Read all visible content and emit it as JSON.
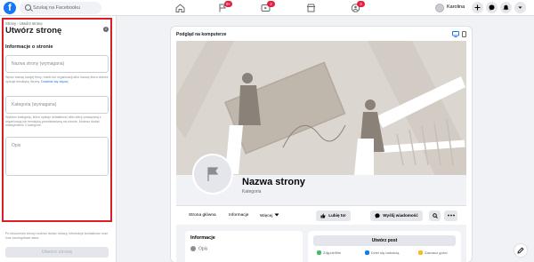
{
  "header": {
    "logo": "f",
    "search_placeholder": "Szukaj na Facebooku",
    "nav_badges": {
      "flag": "9+",
      "watch": "2",
      "groups": "3"
    },
    "profile_name": "Karolina"
  },
  "left": {
    "breadcrumb": [
      "Strony",
      "Utwórz stronę"
    ],
    "title": "Utwórz stronę",
    "section_title": "Informacje o stronie",
    "name_placeholder": "Nazwa strony (wymagana)",
    "name_help": "Wpisz nazwę swojej firmy, marki lub organizacji albo nazwę która dobrze opisuje tematykę Strony.",
    "name_help_link": "Dowiedz się więcej",
    "category_placeholder": "Kategoria (wymagana)",
    "category_help": "Wybierz kategorię, która opisuje działalność albo sferę powiązaną z organizacją lub tematyką przedstawianą na stronie. Możesz dodać maksymalnie 3 kategorie.",
    "description_placeholder": "Opis",
    "footnote": "Po utworzeniu strony możesz dodać obrazy, informacje kontaktowe oraz inne szczegółowe dane.",
    "create_button": "Utwórz stronę"
  },
  "preview": {
    "label": "Podgląd na komputerze",
    "page_name": "Nazwa strony",
    "category": "Kategoria",
    "tabs": [
      "Strona główna",
      "Informacje",
      "Więcej"
    ],
    "like_button": "Lubię to!",
    "message_button": "Wyślij wiadomość",
    "info_header": "Informacje",
    "info_row": "Opis",
    "create_post": "Utwórz post",
    "post_options": [
      "Zdjęcie/film",
      "Dziel się radością",
      "Zaznacz gości"
    ]
  },
  "colors": {
    "accent": "#1877f2",
    "highlight": "#dd1d26",
    "badge": "#e41e3f"
  }
}
